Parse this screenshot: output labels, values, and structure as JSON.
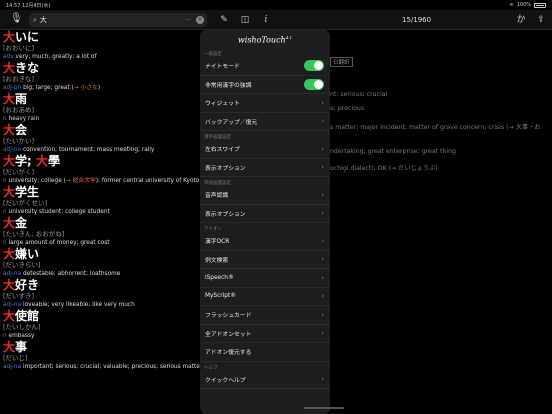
{
  "status": {
    "time": "14:57",
    "date": "12月4日(水)",
    "battery": "100%"
  },
  "toolbar": {
    "search_value": "大",
    "search_dots": "···",
    "counter": "15/1960",
    "kana_button": "か"
  },
  "entries": [
    {
      "k1": "大",
      "k2": "いに",
      "kana": "[おおいに]",
      "pos": "adv",
      "text": " very; much; greatly; a lot of",
      "xref": ""
    },
    {
      "k1": "大",
      "k2": "きな",
      "kana": "[おおきな]",
      "pos": "adj-pn",
      "text": " big; large; great (",
      "xref": "→ 小さな",
      "tail": ")"
    },
    {
      "k1": "大",
      "k2": "雨",
      "kana": "[おおあめ]",
      "pos": "n",
      "text": " heavy rain",
      "xref": ""
    },
    {
      "k1": "大",
      "k2": "会",
      "kana": "[たいかい]",
      "pos": "adj-no",
      "text": " convention; tournament; mass meeting; rally",
      "xref": ""
    },
    {
      "k1": "大",
      "k2": "学; ",
      "k3": "大",
      "k4": "學",
      "kana": "[だいがく]",
      "pos": "n",
      "text": " university; college (",
      "xref": "→ 総合大学",
      "tail": "); former central university of Kyoto"
    },
    {
      "k1": "大",
      "k2": "学生",
      "kana": "[だいがくせい]",
      "pos": "n",
      "text": " university student; college student",
      "xref": ""
    },
    {
      "k1": "大",
      "k2": "金",
      "kana": "[たいきん; おおがね]",
      "pos": "n",
      "text": " large amount of money; great cost",
      "xref": ""
    },
    {
      "k1": "大",
      "k2": "嫌い",
      "kana": "[だいきらい]",
      "pos": "adj-na",
      "text": " detestable; abhorrent; loathsome",
      "xref": ""
    },
    {
      "k1": "大",
      "k2": "好き",
      "kana": "[だいすき]",
      "pos": "adj-na",
      "text": " loveable; very likeable; like very much",
      "xref": ""
    },
    {
      "k1": "大",
      "k2": "使館",
      "kana": "[たいしかん]",
      "pos": "n",
      "text": " embassy",
      "xref": ""
    },
    {
      "k1": "大",
      "k2": "事",
      "kana": "[だいじ]",
      "pos": "adj-na",
      "text": " important; serious; crucial; valuable; precious; serious matter; major ind",
      "xref": ""
    }
  ],
  "detail": {
    "tag": "日翻訳",
    "lines": [
      "nt; serious; crucial",
      "e; precious",
      "s matter; major incident; matter of grave concern; crisis (→ 大事・お",
      "ndertaking; great enterprise; great thing",
      "ochigi dialect); OK (→ だいじょうぶ)"
    ]
  },
  "menu": {
    "logo": "wishoTouch",
    "logo_sup": "4.1",
    "sections": [
      {
        "header": "一般設定",
        "items": [
          {
            "label": "ナイトモード",
            "kind": "toggle",
            "on": true
          },
          {
            "label": "非常用漢字の強調",
            "kind": "toggle",
            "on": true
          },
          {
            "label": "ウィジェット",
            "kind": "chevron"
          },
          {
            "label": "バックアップ／復元",
            "kind": "chevron"
          }
        ]
      },
      {
        "header": "漢字画面設定",
        "items": [
          {
            "label": "左右スワイプ",
            "kind": "chevron"
          },
          {
            "label": "表示オプション",
            "kind": "chevron"
          }
        ]
      },
      {
        "header": "単語画面設定",
        "items": [
          {
            "label": "音声認識",
            "kind": "chevron"
          },
          {
            "label": "表示オプション",
            "kind": "chevron"
          }
        ]
      },
      {
        "header": "アドオン",
        "items": [
          {
            "label": "漢字OCR",
            "kind": "chevron"
          },
          {
            "label": "例文検索",
            "kind": "chevron"
          },
          {
            "label": "iSpeech®",
            "kind": "chevron"
          },
          {
            "label": "MyScript®",
            "kind": "chevron"
          },
          {
            "label": "フラッシュカード",
            "kind": "chevron"
          },
          {
            "label": "全アドオンセット",
            "kind": "chevron"
          },
          {
            "label": "アドオン復元する",
            "kind": "none"
          }
        ]
      },
      {
        "header": "ヘルプ",
        "items": [
          {
            "label": "クイックヘルプ",
            "kind": "chevron"
          }
        ]
      }
    ]
  }
}
